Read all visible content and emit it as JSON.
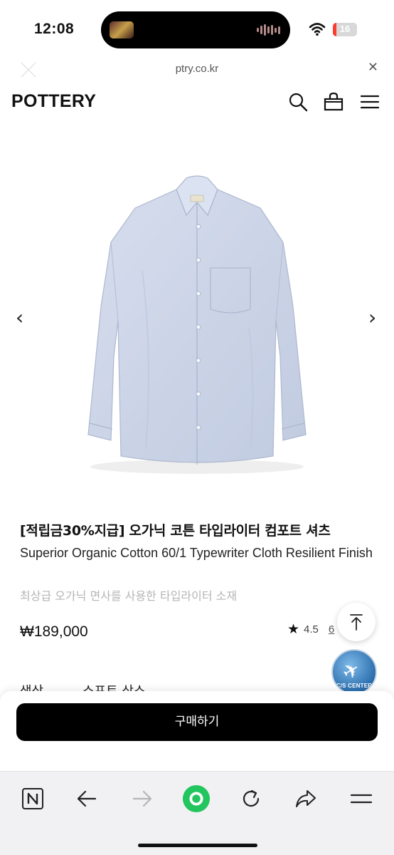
{
  "status_bar": {
    "time": "12:08",
    "battery_level": "16",
    "battery_fraction": 0.16
  },
  "browser": {
    "url": "ptry.co.kr"
  },
  "site": {
    "logo": "POTTERY"
  },
  "product": {
    "title": "[적립금30%지급] 오가닉 코튼 타입라이터 컴포트 셔츠",
    "subtitle": "Superior Organic Cotton 60/1 Typewriter Cloth Resilient Finish",
    "description": "최상급 오가닉 면사를 사용한 타입라이터 소재",
    "price": "₩189,000",
    "rating": "4.5",
    "review_count": "6",
    "option_label": "색상",
    "option_value": "소프트 삭스"
  },
  "cs_center": {
    "label": "C/S CENTER"
  },
  "actions": {
    "buy_label": "구매하기"
  },
  "colors": {
    "shirt": "#c9d3e6",
    "buy_button": "#000000",
    "toolbar_green": "#22c55e",
    "battery_red": "#ff3b30"
  },
  "icons": {
    "header": [
      "search-icon",
      "bag-icon",
      "menu-icon"
    ],
    "toolbar": [
      "naver-n-icon",
      "back-arrow-icon",
      "forward-arrow-icon",
      "green-home-icon",
      "refresh-icon",
      "share-icon",
      "more-menu-icon"
    ]
  }
}
